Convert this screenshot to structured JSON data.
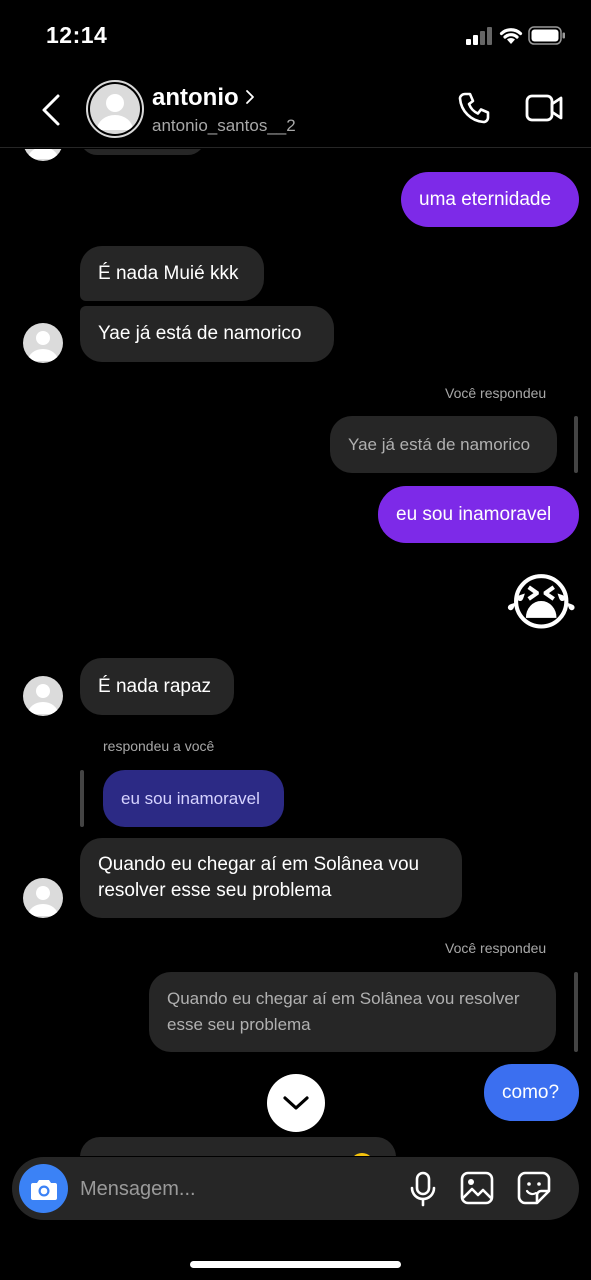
{
  "status_bar": {
    "time": "12:14"
  },
  "header": {
    "name": "antonio",
    "handle": "antonio_santos__2"
  },
  "messages": {
    "out_1": "uma eternidade",
    "in_1": "É nada Muié kkk",
    "in_2": "Yae já está de namorico",
    "you_replied_1": "Você respondeu",
    "quote_1": "Yae já está de namorico",
    "out_2": "eu sou inamoravel",
    "emoji_1": "😭",
    "in_3": "É nada rapaz",
    "replied_to_you": "respondeu a você",
    "quote_2": "eu sou inamoravel",
    "in_4_line1": "Quando eu chegar aí em Solânea vou",
    "in_4_line2": "resolver esse seu problema",
    "you_replied_2": "Você respondeu",
    "quote_3_line1": "Quando eu chegar aí em Solânea vou resolver",
    "quote_3_line2": "esse seu problema",
    "out_3": "como?"
  },
  "composer": {
    "placeholder": "Mensagem..."
  },
  "colors": {
    "outgoing_purple": "#7d2ae8",
    "outgoing_blue": "#3b6ff0",
    "incoming": "#262626",
    "camera_button": "#3b82f6"
  }
}
